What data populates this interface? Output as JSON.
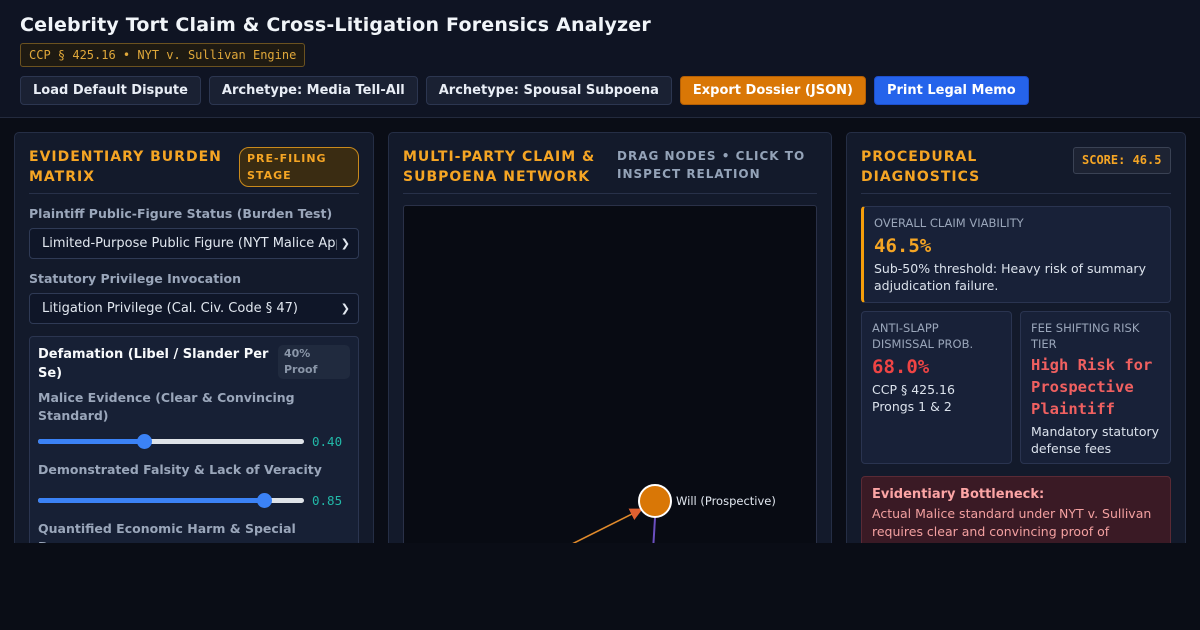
{
  "header": {
    "title": "Celebrity Tort Claim & Cross-Litigation Forensics Analyzer",
    "engine_badge": "CCP § 425.16 • NYT v. Sullivan Engine",
    "buttons": {
      "load_default": "Load Default Dispute",
      "archetype_media": "Archetype: Media Tell-All",
      "archetype_spousal": "Archetype: Spousal Subpoena",
      "export": "Export Dossier (JSON)",
      "print": "Print Legal Memo"
    }
  },
  "left": {
    "title": "EVIDENTIARY BURDEN MATRIX",
    "stage": "PRE-FILING STAGE",
    "public_figure_label": "Plaintiff Public-Figure Status (Burden Test)",
    "public_figure_value": "Limited-Purpose Public Figure (NYT Malice Applied)",
    "privilege_label": "Statutory Privilege Invocation",
    "privilege_value": "Litigation Privilege (Cal. Civ. Code § 47)",
    "claim": {
      "title": "Defamation (Libel / Slander Per Se)",
      "proof_badge": "40% Proof",
      "sliders": [
        {
          "label": "Malice Evidence (Clear & Convincing Standard)",
          "value": 0.4,
          "display": "0.40"
        },
        {
          "label": "Demonstrated Falsity & Lack of Veracity",
          "value": 0.85,
          "display": "0.85"
        },
        {
          "label": "Quantified Economic Harm & Special Damages"
        }
      ]
    }
  },
  "mid": {
    "title": "MULTI-PARTY CLAIM & SUBPOENA NETWORK",
    "hint": "DRAG NODES • CLICK TO INSPECT RELATION",
    "nodes": [
      {
        "label": "Will (Prospective)",
        "color": "#d97706"
      }
    ]
  },
  "right": {
    "title": "PROCEDURAL DIAGNOSTICS",
    "score": "SCORE: 46.5",
    "viability": {
      "label": "OVERALL CLAIM VIABILITY",
      "value": "46.5%",
      "desc": "Sub-50% threshold: Heavy risk of summary adjudication failure."
    },
    "anti_slapp": {
      "label": "ANTI-SLAPP DISMISSAL PROB.",
      "value": "68.0%",
      "desc": "CCP § 425.16 Prongs 1 & 2"
    },
    "fee_risk": {
      "label": "FEE SHIFTING RISK TIER",
      "value": "High Risk for Prospective Plaintiff",
      "desc": "Mandatory statutory defense fees"
    },
    "bottleneck": {
      "title": "Evidentiary Bottleneck:",
      "text": "Actual Malice standard under NYT v. Sullivan requires clear and convincing proof of"
    }
  },
  "colors": {
    "accent": "#f5a524",
    "danger": "#ef4444",
    "primary": "#2563eb",
    "export": "#d97706",
    "value_teal": "#22b8a8"
  }
}
